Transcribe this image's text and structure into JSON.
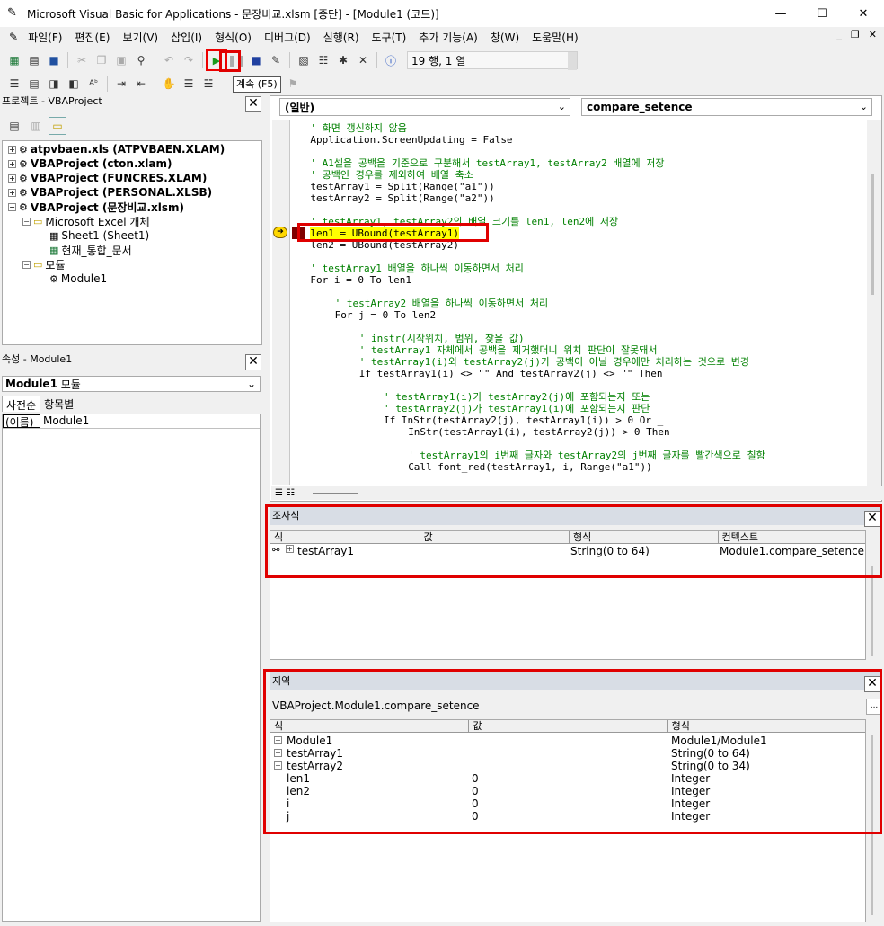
{
  "window": {
    "title": "Microsoft Visual Basic for Applications - 문장비교.xlsm [중단] - [Module1 (코드)]",
    "minimize": "—",
    "maximize": "☐",
    "close": "✕"
  },
  "menu": [
    "파일(F)",
    "편집(E)",
    "보기(V)",
    "삽입(I)",
    "형식(O)",
    "디버그(D)",
    "실행(R)",
    "도구(T)",
    "추가 기능(A)",
    "창(W)",
    "도움말(H)"
  ],
  "mdi": {
    "min": "_",
    "restore": "❐",
    "close": "✕"
  },
  "toolbar": {
    "position": "19 행, 1 열",
    "tooltip": "계속 (F5)"
  },
  "project": {
    "title": "프로젝트 - VBAProject",
    "items": [
      {
        "label": "atpvbaen.xls (ATPVBAEN.XLAM)"
      },
      {
        "label": "VBAProject (cton.xlam)"
      },
      {
        "label": "VBAProject (FUNCRES.XLAM)"
      },
      {
        "label": "VBAProject (PERSONAL.XLSB)"
      },
      {
        "label": "VBAProject (문장비교.xlsm)"
      },
      {
        "label": "Microsoft Excel 개체"
      },
      {
        "label": "Sheet1 (Sheet1)"
      },
      {
        "label": "현재_통합_문서"
      },
      {
        "label": "모듈"
      },
      {
        "label": "Module1"
      }
    ]
  },
  "properties": {
    "title": "속성 - Module1",
    "object": "Module1",
    "object_type": "모듈",
    "tabs": [
      "사전순",
      "항목별"
    ],
    "rows": [
      {
        "name": "(이름)",
        "value": "Module1"
      }
    ]
  },
  "code": {
    "object_combo": "(일반)",
    "proc_combo": "compare_setence",
    "lines": [
      {
        "text": "' 화면 갱신하지 않음",
        "indent": 3,
        "type": "cm"
      },
      {
        "text": "Application.ScreenUpdating = False",
        "indent": 3,
        "type": "code"
      },
      {
        "text": "",
        "indent": 0,
        "type": "code"
      },
      {
        "text": "' A1셀을 공백을 기준으로 구분해서 testArray1, testArray2 배열에 저장",
        "indent": 3,
        "type": "cm"
      },
      {
        "text": "' 공백인 경우를 제외하여 배열 축소",
        "indent": 3,
        "type": "cm"
      },
      {
        "text": "testArray1 = Split(Range(\"a1\"))",
        "indent": 3,
        "type": "code"
      },
      {
        "text": "testArray2 = Split(Range(\"a2\"))",
        "indent": 3,
        "type": "code"
      },
      {
        "text": "",
        "indent": 0,
        "type": "code"
      },
      {
        "text": "' testArray1, testArray2의 배열 크기를 len1, len2에 저장",
        "indent": 3,
        "type": "cm"
      },
      {
        "text": "len1 = UBound(testArray1)",
        "indent": 3,
        "type": "hl"
      },
      {
        "text": "len2 = UBound(testArray2)",
        "indent": 3,
        "type": "code"
      },
      {
        "text": "",
        "indent": 0,
        "type": "code"
      },
      {
        "text": "' testArray1 배열을 하나씩 이동하면서 처리",
        "indent": 3,
        "type": "cm"
      },
      {
        "text": "For i = 0 To len1",
        "indent": 3,
        "type": "code"
      },
      {
        "text": "",
        "indent": 0,
        "type": "code"
      },
      {
        "text": "' testArray2 배열을 하나씩 이동하면서 처리",
        "indent": 7,
        "type": "cm"
      },
      {
        "text": "For j = 0 To len2",
        "indent": 7,
        "type": "code"
      },
      {
        "text": "",
        "indent": 0,
        "type": "code"
      },
      {
        "text": "' instr(시작위치, 범위, 찾을 값)",
        "indent": 11,
        "type": "cm"
      },
      {
        "text": "' testArray1 자체에서 공백을 제거했더니 위치 판단이 잘못돼서",
        "indent": 11,
        "type": "cm"
      },
      {
        "text": "' testArray1(i)와 testArray2(j)가 공백이 아닐 경우에만 처리하는 것으로 변경",
        "indent": 11,
        "type": "cm"
      },
      {
        "text": "If testArray1(i) <> \"\" And testArray2(j) <> \"\" Then",
        "indent": 11,
        "type": "code"
      },
      {
        "text": "",
        "indent": 0,
        "type": "code"
      },
      {
        "text": "' testArray1(i)가 testArray2(j)에 포함되는지 또는",
        "indent": 15,
        "type": "cm"
      },
      {
        "text": "' testArray2(j)가 testArray1(i)에 포함되는지 판단",
        "indent": 15,
        "type": "cm"
      },
      {
        "text": "If InStr(testArray2(j), testArray1(i)) > 0 Or _",
        "indent": 15,
        "type": "code"
      },
      {
        "text": "InStr(testArray1(i), testArray2(j)) > 0 Then",
        "indent": 19,
        "type": "code"
      },
      {
        "text": "",
        "indent": 0,
        "type": "code"
      },
      {
        "text": "' testArray1의 i번째 글자와 testArray2의 j번째 글자를 빨간색으로 칠함",
        "indent": 19,
        "type": "cm"
      },
      {
        "text": "Call font_red(testArray1, i, Range(\"a1\"))",
        "indent": 19,
        "type": "code"
      }
    ]
  },
  "watch": {
    "title": "조사식",
    "headers": [
      "식",
      "값",
      "형식",
      "컨텍스트"
    ],
    "rows": [
      {
        "expr": "testArray1",
        "value": "",
        "type": "String(0 to 64)",
        "context": "Module1.compare_setence"
      }
    ]
  },
  "locals": {
    "title": "지역",
    "context": "VBAProject.Module1.compare_setence",
    "context_btn": "...",
    "headers": [
      "식",
      "값",
      "형식"
    ],
    "rows": [
      {
        "expr": "Module1",
        "value": "",
        "type": "Module1/Module1",
        "expandable": true
      },
      {
        "expr": "testArray1",
        "value": "",
        "type": "String(0 to 64)",
        "expandable": true
      },
      {
        "expr": "testArray2",
        "value": "",
        "type": "String(0 to 34)",
        "expandable": true
      },
      {
        "expr": "len1",
        "value": "0",
        "type": "Integer",
        "expandable": false
      },
      {
        "expr": "len2",
        "value": "0",
        "type": "Integer",
        "expandable": false
      },
      {
        "expr": "i",
        "value": "0",
        "type": "Integer",
        "expandable": false
      },
      {
        "expr": "j",
        "value": "0",
        "type": "Integer",
        "expandable": false
      }
    ]
  },
  "colors": {
    "accent_red": "#e00000",
    "highlight": "#ffff00",
    "comment": "#008000",
    "keyword": "#00008b"
  }
}
